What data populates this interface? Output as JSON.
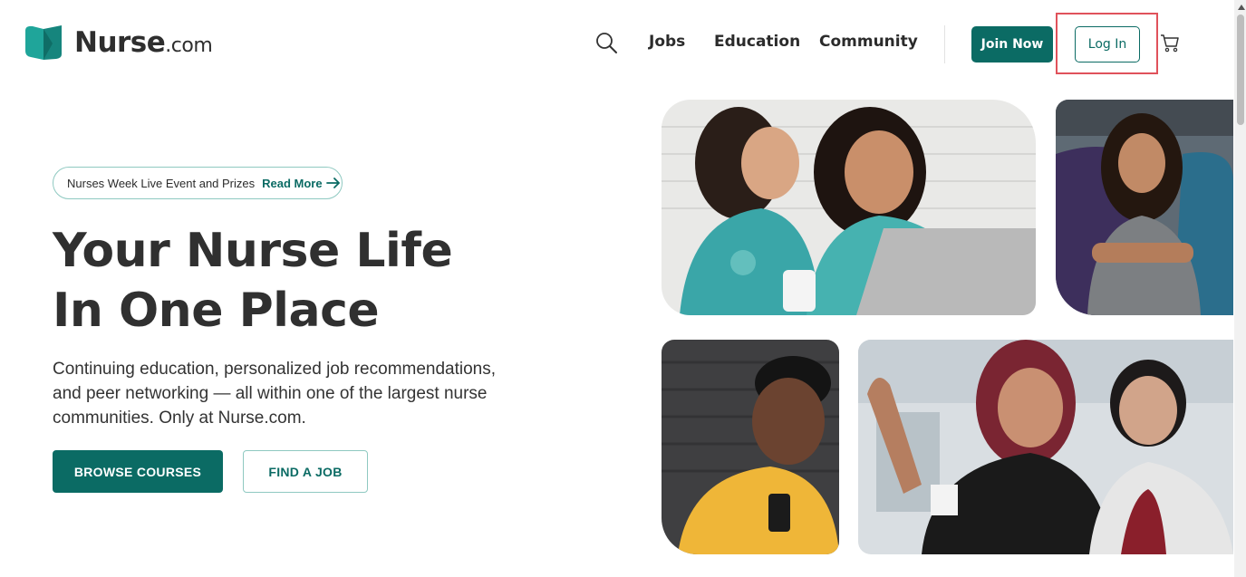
{
  "header": {
    "logo_main": "Nurse",
    "logo_suffix": ".com",
    "nav": {
      "jobs": "Jobs",
      "education": "Education",
      "community": "Community"
    },
    "join_label": "Join Now",
    "login_label": "Log In"
  },
  "hero": {
    "promo_text": "Nurses Week Live Event and Prizes",
    "promo_link": "Read More",
    "title_line1": "Your Nurse Life",
    "title_line2": "In One Place",
    "subtitle": "Continuing education, personalized job recommendations, and peer networking — all within one of the largest nurse communities. Only at Nurse.com.",
    "browse_label": "BROWSE COURSES",
    "find_job_label": "FIND A JOB"
  },
  "icons": [
    "logo-icon",
    "search-icon",
    "cart-icon",
    "arrow-right-icon"
  ],
  "colors": {
    "brand_teal": "#0b6b64",
    "logo_teal": "#1fa59a",
    "highlight": "#e0525b"
  }
}
